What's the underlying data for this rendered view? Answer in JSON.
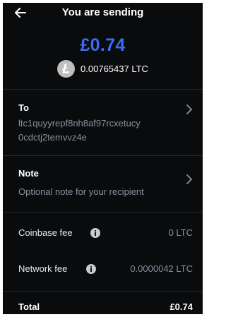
{
  "header": {
    "title": "You are sending",
    "back_icon": "arrow-left-icon"
  },
  "amount": {
    "fiat": "£0.74",
    "crypto": "0.00765437 LTC",
    "coin_icon": "litecoin-icon"
  },
  "recipient": {
    "label": "To",
    "address_line1": "ltc1quyyrepf8nh8af97rcxetucy",
    "address_line2": "0cdctj2temvvz4e",
    "chevron_icon": "chevron-right-icon"
  },
  "note": {
    "label": "Note",
    "placeholder": "Optional note for your recipient",
    "chevron_icon": "chevron-right-icon"
  },
  "fees": {
    "coinbase_label": "Coinbase fee",
    "coinbase_value": "0 LTC",
    "network_label": "Network fee",
    "network_value": "0.0000042 LTC",
    "info_icon": "info-icon"
  },
  "total": {
    "label": "Total",
    "value": "£0.74"
  },
  "colors": {
    "background": "#0a0b0d",
    "accent": "#3b6cf2",
    "muted_text": "#8a919e",
    "divider": "#26282d"
  }
}
